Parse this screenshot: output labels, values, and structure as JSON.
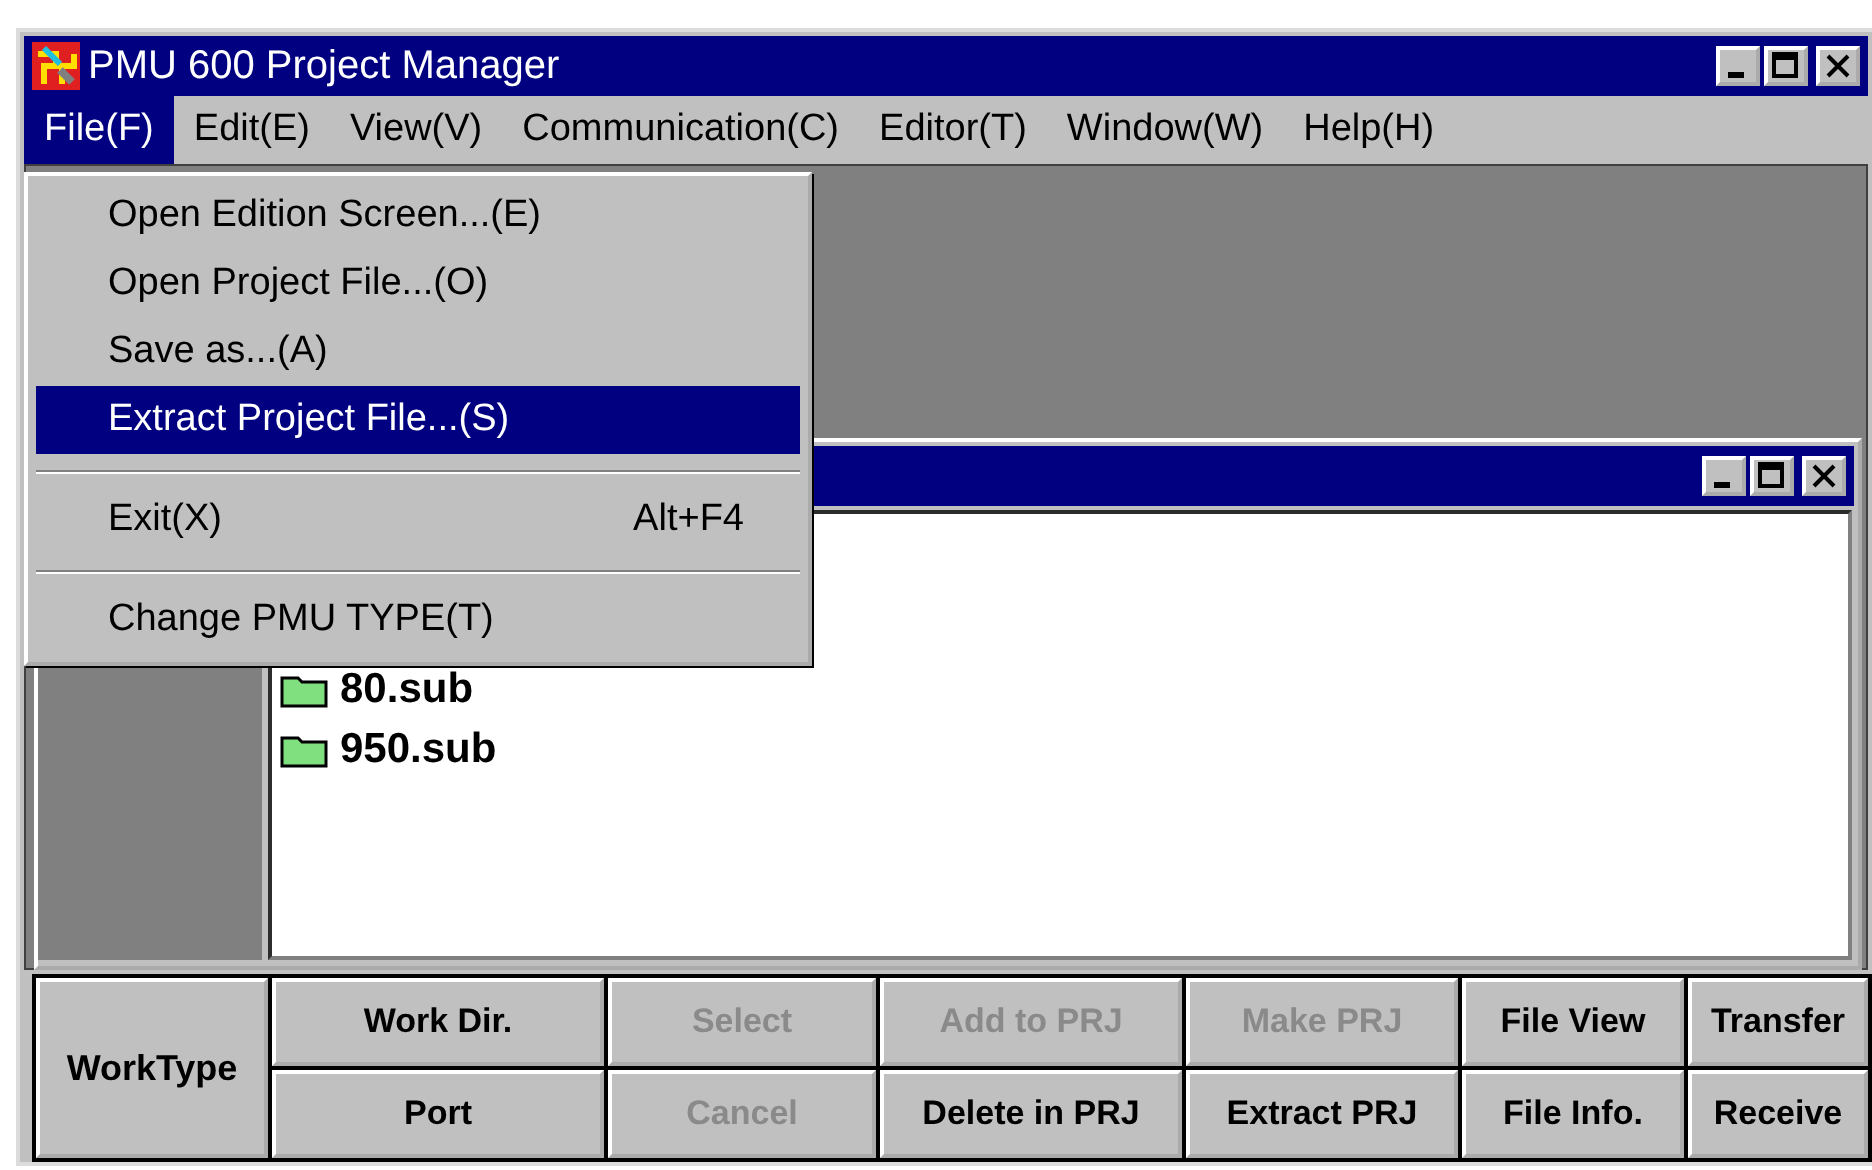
{
  "window": {
    "title": "PMU 600 Project Manager"
  },
  "menu_bar": [
    {
      "label": "File(F)",
      "selected": true
    },
    {
      "label": "Edit(E)",
      "selected": false
    },
    {
      "label": "View(V)",
      "selected": false
    },
    {
      "label": "Communication(C)",
      "selected": false
    },
    {
      "label": "Editor(T)",
      "selected": false
    },
    {
      "label": "Window(W)",
      "selected": false
    },
    {
      "label": "Help(H)",
      "selected": false
    }
  ],
  "file_menu": [
    {
      "kind": "item",
      "label": "Open Edition Screen...(E)",
      "selected": false
    },
    {
      "kind": "item",
      "label": "Open Project File...(O)",
      "selected": false
    },
    {
      "kind": "item",
      "label": "Save as...(A)",
      "selected": false
    },
    {
      "kind": "item",
      "label": "Extract Project File...(S)",
      "selected": true
    },
    {
      "kind": "separator"
    },
    {
      "kind": "item",
      "label": "Exit(X)",
      "shortcut": "Alt+F4",
      "selected": false
    },
    {
      "kind": "separator"
    },
    {
      "kind": "item",
      "label": "Change PMU TYPE(T)",
      "selected": false
    }
  ],
  "child_window": {
    "tree_items": [
      {
        "label": "80.sub"
      },
      {
        "label": "950.sub"
      }
    ]
  },
  "work_panel": {
    "label": "WorkType",
    "rows": [
      [
        {
          "label": "Work Dir.",
          "disabled": false
        },
        {
          "label": "Select",
          "disabled": true
        },
        {
          "label": "Add to PRJ",
          "disabled": true
        },
        {
          "label": "Make PRJ",
          "disabled": true
        },
        {
          "label": "File View",
          "disabled": false
        },
        {
          "label": "Transfer",
          "disabled": false
        }
      ],
      [
        {
          "label": "Port",
          "disabled": false
        },
        {
          "label": "Cancel",
          "disabled": true
        },
        {
          "label": "Delete in PRJ",
          "disabled": false
        },
        {
          "label": "Extract PRJ",
          "disabled": false
        },
        {
          "label": "File Info.",
          "disabled": false
        },
        {
          "label": "Receive",
          "disabled": false
        }
      ]
    ]
  }
}
